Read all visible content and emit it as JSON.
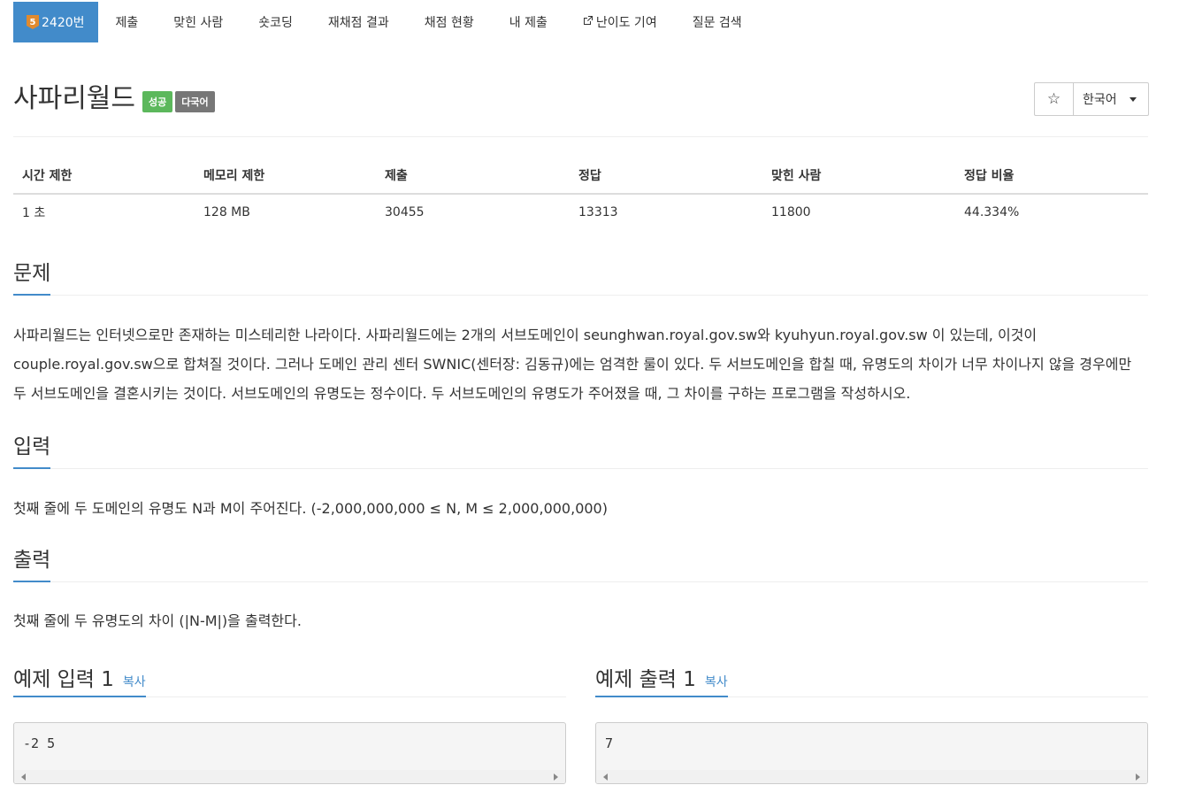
{
  "nav": {
    "problem_tier": "5",
    "problem_id": "2420번",
    "tabs": [
      "제출",
      "맞힌 사람",
      "숏코딩",
      "재채점 결과",
      "채점 현황",
      "내 제출",
      "난이도 기여",
      "질문 검색"
    ]
  },
  "problem": {
    "title": "사파리월드",
    "badges": [
      "성공",
      "다국어"
    ],
    "star_icon": "star-outline-icon",
    "language": "한국어"
  },
  "info": {
    "headers": [
      "시간 제한",
      "메모리 제한",
      "제출",
      "정답",
      "맞힌 사람",
      "정답 비율"
    ],
    "values": [
      "1 초",
      "128 MB",
      "30455",
      "13313",
      "11800",
      "44.334%"
    ]
  },
  "sections": {
    "description_title": "문제",
    "description": "사파리월드는 인터넷으로만 존재하는 미스테리한 나라이다. 사파리월드에는 2개의 서브도메인이 seunghwan.royal.gov.sw와 kyuhyun.royal.gov.sw 이 있는데, 이것이 couple.royal.gov.sw으로 합쳐질 것이다. 그러나 도메인 관리 센터 SWNIC(센터장: 김동규)에는 엄격한 룰이 있다. 두 서브도메인을 합칠 때, 유명도의 차이가 너무 차이나지 않을 경우에만 두 서브도메인을 결혼시키는 것이다. 서브도메인의 유명도는 정수이다. 두 서브도메인의 유명도가 주어졌을 때, 그 차이를 구하는 프로그램을 작성하시오.",
    "input_title": "입력",
    "input": "첫째 줄에 두 도메인의 유명도 N과 M이 주어진다. (-2,000,000,000 ≤ N, M ≤ 2,000,000,000)",
    "output_title": "출력",
    "output": "첫째 줄에 두 유명도의 차이 (|N-M|)을 출력한다."
  },
  "samples": {
    "input_title": "예제 입력 1",
    "output_title": "예제 출력 1",
    "copy_label": "복사",
    "input_value": "-2 5",
    "output_value": "7"
  }
}
